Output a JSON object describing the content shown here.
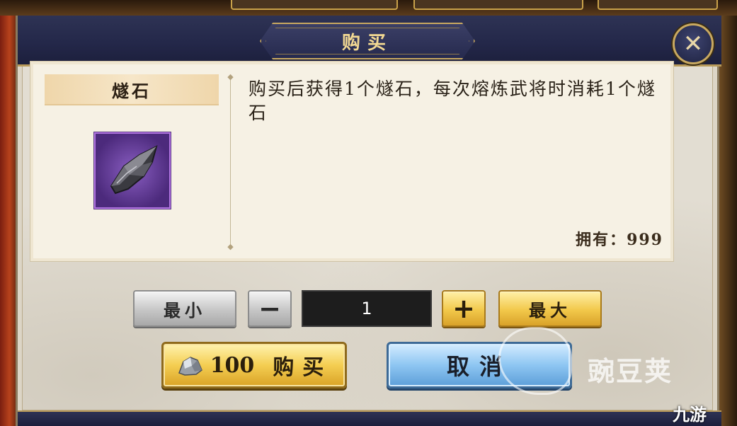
{
  "dialog": {
    "title": "购买",
    "close_glyph": "✕"
  },
  "item": {
    "name": "燧石",
    "description": "购买后获得1个燧石，每次熔炼武将时消耗1个燧石",
    "owned_label": "拥有：",
    "owned_count": "999",
    "icon": "flint-stone-icon"
  },
  "quantity": {
    "min_label": "最小",
    "minus_glyph": "−",
    "value": "1",
    "plus_glyph": "+",
    "max_label": "最大"
  },
  "actions": {
    "cost_icon": "silver-ore-icon",
    "cost": "100",
    "buy_label": "购买",
    "cancel_label": "取消"
  },
  "watermarks": {
    "wandoujia": "豌豆荚",
    "jiuyou": "九游"
  },
  "colors": {
    "header": "#24284a",
    "gold_accent": "#c9a960",
    "panel": "#f6f1e4",
    "item_frame_purple": "#b274e2",
    "buy_button": "#f4ce52",
    "cancel_button": "#8ec6f2"
  }
}
